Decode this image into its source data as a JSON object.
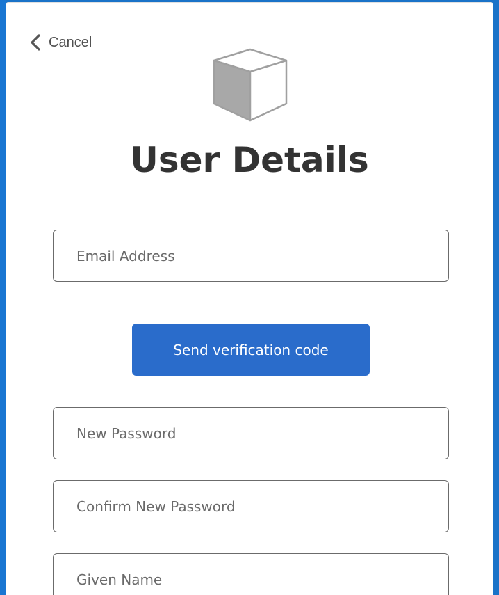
{
  "header": {
    "cancel_label": "Cancel",
    "title": "User Details"
  },
  "logo": {
    "icon": "cube-icon"
  },
  "form": {
    "email": {
      "placeholder": "Email Address",
      "value": ""
    },
    "send_code_label": "Send verification code",
    "new_password": {
      "placeholder": "New Password",
      "value": ""
    },
    "confirm_password": {
      "placeholder": "Confirm New Password",
      "value": ""
    },
    "given_name": {
      "placeholder": "Given Name",
      "value": ""
    }
  },
  "colors": {
    "accent": "#2a6ccb",
    "page_background": "#1976d2",
    "title": "#333333"
  }
}
